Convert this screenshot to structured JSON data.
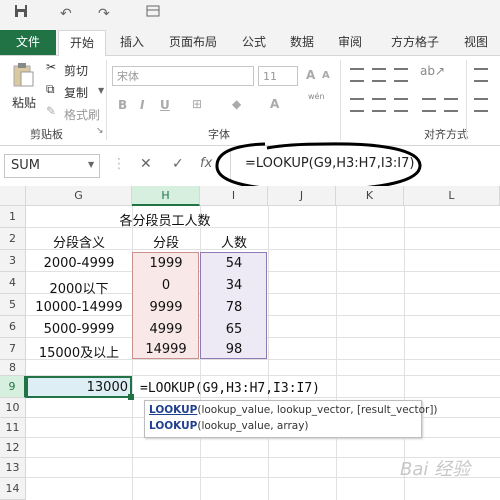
{
  "quick_access": {
    "undo": "↶",
    "redo": "↷"
  },
  "tabs": [
    "文件",
    "开始",
    "插入",
    "页面布局",
    "公式",
    "数据",
    "审阅",
    "方方格子",
    "视图"
  ],
  "ribbon": {
    "cut": "剪切",
    "copy": "复制",
    "format_painter": "格式刷",
    "paste": "粘贴",
    "clipboard_label": "剪贴板",
    "font_name": "宋体",
    "font_size": "11",
    "font_label": "字体",
    "wen": "wén",
    "align_label": "对齐方式",
    "bold": "B",
    "italic": "I",
    "underline": "U"
  },
  "formula_bar": {
    "name_box": "SUM",
    "cancel": "✕",
    "enter": "✓",
    "fx": "fx",
    "formula": "=LOOKUP(G9,H3:H7,I3:I7)"
  },
  "grid": {
    "columns": [
      "G",
      "H",
      "I",
      "J",
      "K",
      "L"
    ],
    "rows": [
      "1",
      "2",
      "3",
      "4",
      "5",
      "6",
      "7",
      "8",
      "9",
      "10",
      "11",
      "12",
      "13",
      "14"
    ],
    "title": "各分段员工人数",
    "headers": [
      "分段含义",
      "分段",
      "人数"
    ],
    "data": [
      [
        "2000-4999",
        "1999",
        "54"
      ],
      [
        "2000以下",
        "0",
        "34"
      ],
      [
        "10000-14999",
        "9999",
        "78"
      ],
      [
        "5000-9999",
        "4999",
        "65"
      ],
      [
        "15000及以上",
        "14999",
        "98"
      ]
    ],
    "g9": "13000",
    "editing_formula": "=LOOKUP(G9,H3:H7,I3:I7)"
  },
  "tooltip": {
    "line1_func": "LOOKUP",
    "line1_args": "(lookup_value, lookup_vector, [result_vector])",
    "line2_func": "LOOKUP",
    "line2_args": "(lookup_value, array)"
  },
  "watermark": "Bai 经验"
}
